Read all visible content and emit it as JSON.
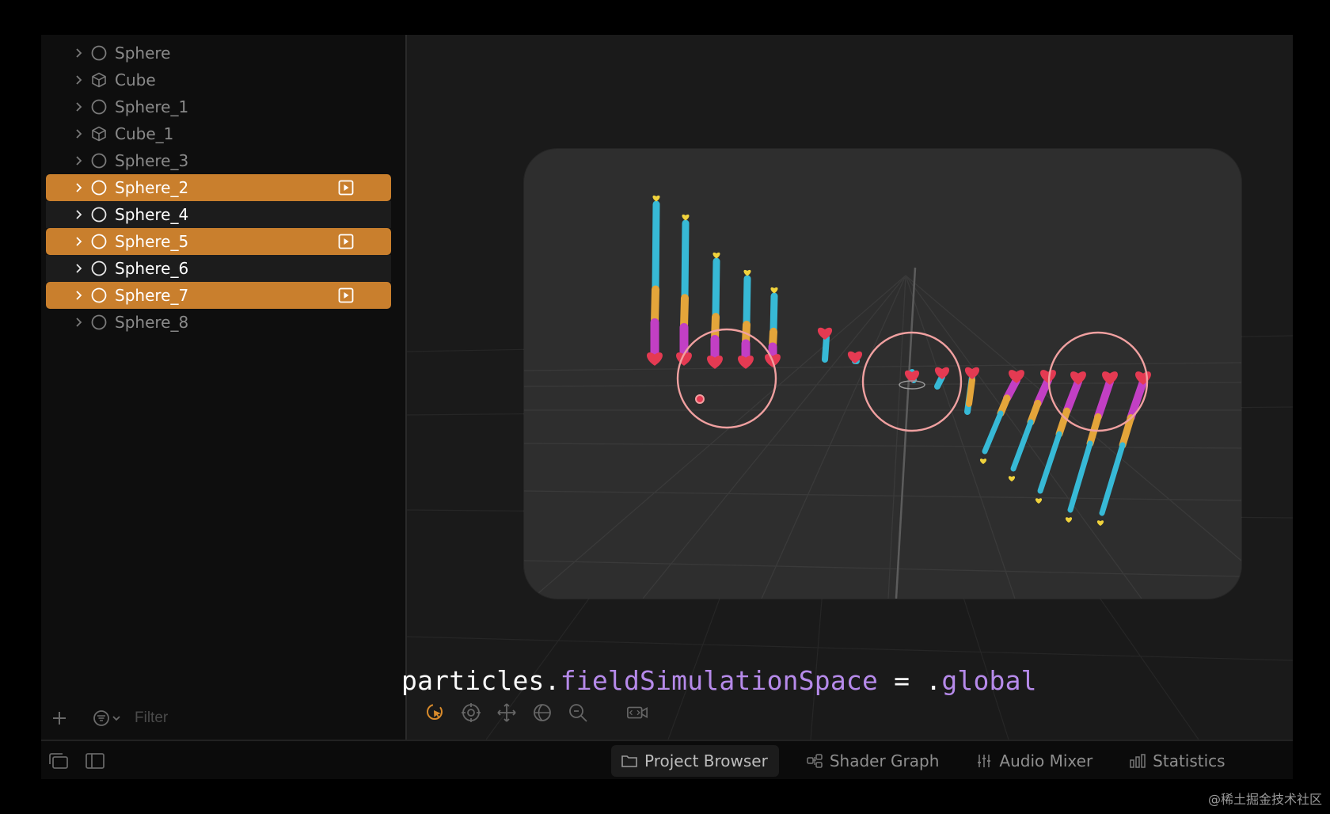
{
  "outline": {
    "items": [
      {
        "label": "Sphere",
        "icon": "sphere",
        "style": "dim"
      },
      {
        "label": "Cube",
        "icon": "cube",
        "style": "dim"
      },
      {
        "label": "Sphere_1",
        "icon": "sphere",
        "style": "dim"
      },
      {
        "label": "Cube_1",
        "icon": "cube",
        "style": "dim"
      },
      {
        "label": "Sphere_3",
        "icon": "sphere",
        "style": "dim"
      },
      {
        "label": "Sphere_2",
        "icon": "sphere",
        "style": "selected"
      },
      {
        "label": "Sphere_4",
        "icon": "sphere",
        "style": "band"
      },
      {
        "label": "Sphere_5",
        "icon": "sphere",
        "style": "selected"
      },
      {
        "label": "Sphere_6",
        "icon": "sphere",
        "style": "band"
      },
      {
        "label": "Sphere_7",
        "icon": "sphere",
        "style": "selected"
      },
      {
        "label": "Sphere_8",
        "icon": "sphere",
        "style": "dim"
      }
    ],
    "filter_placeholder": "Filter"
  },
  "code": {
    "prefix": "particles.",
    "property": "fieldSimulationSpace",
    "operator": " = .",
    "value": "global"
  },
  "bottom_tabs": [
    {
      "label": "Project Browser",
      "icon": "folder-icon",
      "active": true
    },
    {
      "label": "Shader Graph",
      "icon": "nodes-icon",
      "active": false
    },
    {
      "label": "Audio Mixer",
      "icon": "sliders-icon",
      "active": false
    },
    {
      "label": "Statistics",
      "icon": "bar-chart-icon",
      "active": false
    }
  ],
  "watermark": "@稀土掘金技术社区",
  "colors": {
    "selection": "#c97f2d",
    "code_property": "#b68aea",
    "annotation_circle": "#f0a0a0",
    "particle_cyan": "#37b9d6",
    "particle_orange": "#e4a53a",
    "particle_magenta": "#c23fc4",
    "particle_red": "#e43a52",
    "particle_yellow": "#f0d23c"
  }
}
